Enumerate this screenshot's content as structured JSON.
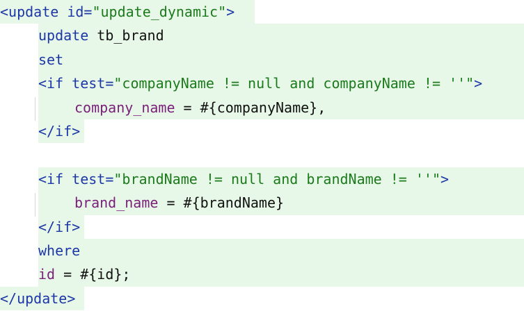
{
  "editor": {
    "colors": {
      "tag": "#1d37a6",
      "string": "#1b7a1b",
      "column": "#7a1f7a",
      "text": "#111111",
      "highlight": "#e8f8e8"
    },
    "lines": [
      {
        "parts": [
          [
            "tag",
            "<update "
          ],
          [
            "attr",
            "id="
          ],
          [
            "str",
            "\"update_dynamic\""
          ],
          [
            "tag",
            ">"
          ]
        ]
      },
      {
        "parts": [
          [
            "kw",
            "update "
          ],
          [
            "plain",
            "tb_brand"
          ]
        ]
      },
      {
        "parts": [
          [
            "kw",
            "set"
          ]
        ]
      },
      {
        "parts": [
          [
            "tag",
            "<if "
          ],
          [
            "attr",
            "test="
          ],
          [
            "str",
            "\"companyName != null and companyName != ''\""
          ],
          [
            "tag",
            ">"
          ]
        ]
      },
      {
        "parts": [
          [
            "col",
            "company_name"
          ],
          [
            "plain",
            " = #{companyName},"
          ]
        ]
      },
      {
        "parts": [
          [
            "tag",
            "</if>"
          ]
        ]
      },
      {
        "parts": []
      },
      {
        "parts": [
          [
            "tag",
            "<if "
          ],
          [
            "attr",
            "test="
          ],
          [
            "str",
            "\"brandName != null and brandName != ''\""
          ],
          [
            "tag",
            ">"
          ]
        ]
      },
      {
        "parts": [
          [
            "col",
            "brand_name"
          ],
          [
            "plain",
            " = #{brandName}"
          ]
        ]
      },
      {
        "parts": [
          [
            "tag",
            "</if>"
          ]
        ]
      },
      {
        "parts": [
          [
            "kw",
            "where"
          ]
        ]
      },
      {
        "parts": [
          [
            "col",
            "id"
          ],
          [
            "plain",
            " = #{id};"
          ]
        ]
      },
      {
        "parts": [
          [
            "tag",
            "</update>"
          ]
        ]
      }
    ]
  }
}
